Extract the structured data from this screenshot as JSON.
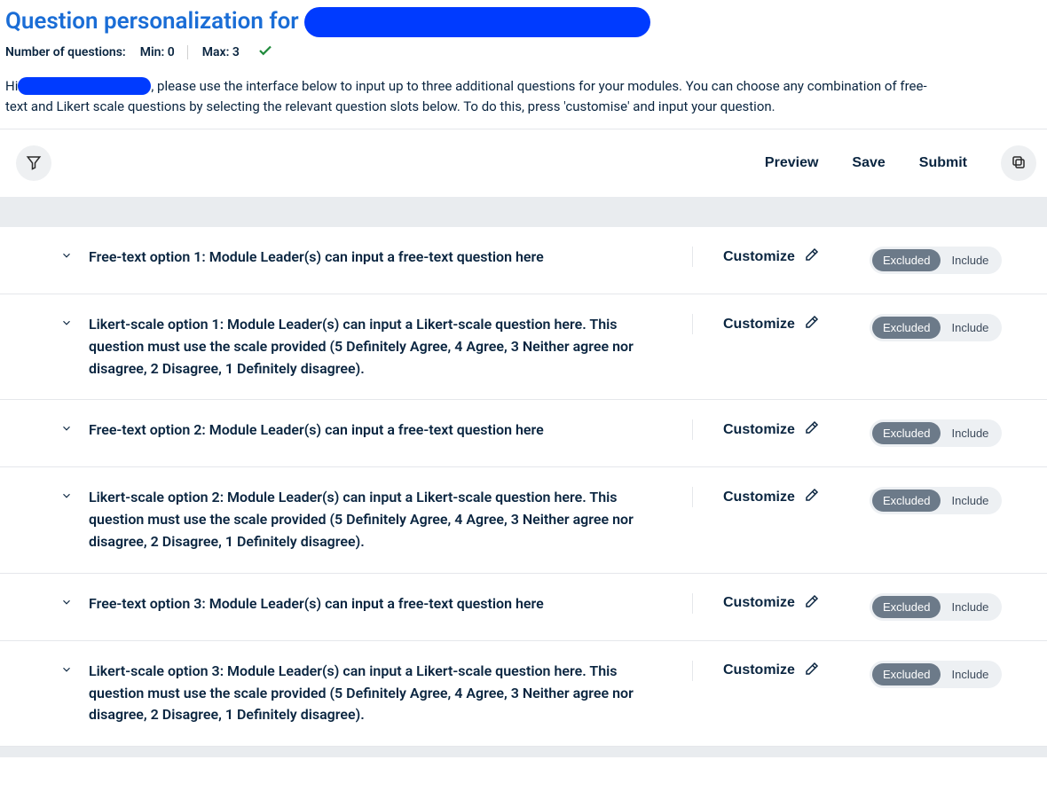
{
  "header": {
    "title_prefix": "Question personalization for",
    "num_questions_label": "Number of questions:",
    "min_label": "Min:",
    "min_value": "0",
    "max_label": "Max:",
    "max_value": "3"
  },
  "intro": {
    "line1_pre": "Hi",
    "line1_post": ", please use the interface below to input up to three additional questions for your modules. You can choose any combination of free-",
    "line2": "text and Likert scale questions by selecting the relevant question slots below. To do this, press 'customise' and input your question."
  },
  "toolbar": {
    "preview": "Preview",
    "save": "Save",
    "submit": "Submit"
  },
  "row_labels": {
    "customize": "Customize",
    "excluded": "Excluded",
    "include": "Include"
  },
  "rows": [
    {
      "text": "Free-text option 1: Module Leader(s) can input a free-text question here"
    },
    {
      "text": "Likert-scale option 1: Module Leader(s) can input a Likert-scale question here. This question must use the scale provided (5 Definitely Agree, 4 Agree, 3 Neither agree nor disagree, 2 Disagree, 1 Definitely disagree)."
    },
    {
      "text": "Free-text option 2: Module Leader(s) can input a free-text question here"
    },
    {
      "text": "Likert-scale option 2: Module Leader(s) can input a Likert-scale question here. This question must use the scale provided (5 Definitely Agree, 4 Agree, 3 Neither agree nor disagree, 2 Disagree, 1 Definitely disagree)."
    },
    {
      "text": "Free-text option 3: Module Leader(s) can input a free-text question here"
    },
    {
      "text": "Likert-scale option 3: Module Leader(s) can input a Likert-scale question here. This question must use the scale provided (5 Definitely Agree, 4 Agree, 3 Neither agree nor disagree, 2 Disagree, 1 Definitely disagree)."
    }
  ]
}
